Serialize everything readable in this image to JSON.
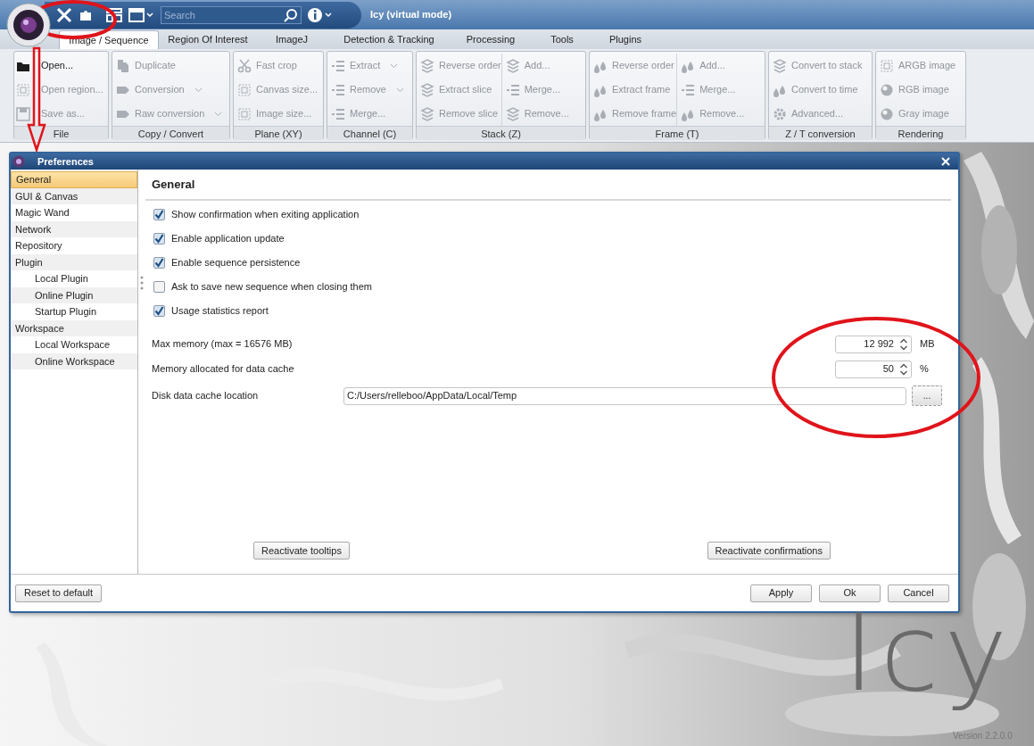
{
  "app_window": {
    "title": "Icy (virtual mode)",
    "search": {
      "placeholder": "Search"
    }
  },
  "ribbon_tabs": [
    {
      "label": "Image / Sequence",
      "selected": true
    },
    {
      "label": "Region Of Interest",
      "selected": false
    },
    {
      "label": "ImageJ",
      "selected": false
    },
    {
      "label": "Detection & Tracking",
      "selected": false
    },
    {
      "label": "Processing",
      "selected": false
    },
    {
      "label": "Tools",
      "selected": false
    },
    {
      "label": "Plugins",
      "selected": false
    }
  ],
  "ribbon_groups": [
    {
      "label": "File",
      "columns": [
        [
          {
            "label": "Open...",
            "disabled": false,
            "dropdown": false
          },
          {
            "label": "Open region...",
            "disabled": true,
            "dropdown": false
          },
          {
            "label": "Save as...",
            "disabled": true,
            "dropdown": false
          }
        ]
      ]
    },
    {
      "label": "Copy / Convert",
      "columns": [
        [
          {
            "label": "Duplicate",
            "disabled": true,
            "dropdown": false
          },
          {
            "label": "Conversion",
            "disabled": true,
            "dropdown": true
          },
          {
            "label": "Raw conversion",
            "disabled": true,
            "dropdown": true
          }
        ]
      ]
    },
    {
      "label": "Plane (XY)",
      "columns": [
        [
          {
            "label": "Fast crop",
            "disabled": true,
            "dropdown": false
          },
          {
            "label": "Canvas size...",
            "disabled": true,
            "dropdown": false
          },
          {
            "label": "Image size...",
            "disabled": true,
            "dropdown": false
          }
        ]
      ]
    },
    {
      "label": "Channel (C)",
      "columns": [
        [
          {
            "label": "Extract",
            "disabled": true,
            "dropdown": true
          },
          {
            "label": "Remove",
            "disabled": true,
            "dropdown": true
          },
          {
            "label": "Merge...",
            "disabled": true,
            "dropdown": false
          }
        ]
      ]
    },
    {
      "label": "Stack (Z)",
      "columns": [
        [
          {
            "label": "Reverse order",
            "disabled": true,
            "dropdown": false
          },
          {
            "label": "Extract slice",
            "disabled": true,
            "dropdown": false
          },
          {
            "label": "Remove slice",
            "disabled": true,
            "dropdown": false
          }
        ],
        [
          {
            "label": "Add...",
            "disabled": true,
            "dropdown": false
          },
          {
            "label": "Merge...",
            "disabled": true,
            "dropdown": false
          },
          {
            "label": "Remove...",
            "disabled": true,
            "dropdown": false
          }
        ]
      ]
    },
    {
      "label": "Frame (T)",
      "columns": [
        [
          {
            "label": "Reverse order",
            "disabled": true,
            "dropdown": false
          },
          {
            "label": "Extract frame",
            "disabled": true,
            "dropdown": false
          },
          {
            "label": "Remove frame",
            "disabled": true,
            "dropdown": false
          }
        ],
        [
          {
            "label": "Add...",
            "disabled": true,
            "dropdown": false
          },
          {
            "label": "Merge...",
            "disabled": true,
            "dropdown": false
          },
          {
            "label": "Remove...",
            "disabled": true,
            "dropdown": false
          }
        ]
      ]
    },
    {
      "label": "Z / T conversion",
      "columns": [
        [
          {
            "label": "Convert to stack",
            "disabled": true,
            "dropdown": false
          },
          {
            "label": "Convert to time",
            "disabled": true,
            "dropdown": false
          },
          {
            "label": "Advanced...",
            "disabled": true,
            "dropdown": false
          }
        ]
      ]
    },
    {
      "label": "Rendering",
      "columns": [
        [
          {
            "label": "ARGB image",
            "disabled": true,
            "dropdown": false
          },
          {
            "label": "RGB image",
            "disabled": true,
            "dropdown": false
          },
          {
            "label": "Gray image",
            "disabled": true,
            "dropdown": false
          }
        ]
      ]
    }
  ],
  "preferences": {
    "title": "Preferences",
    "sidebar": [
      {
        "label": "General",
        "selected": true
      },
      {
        "label": "GUI & Canvas",
        "selected": false
      },
      {
        "label": "Magic Wand",
        "selected": false
      },
      {
        "label": "Network",
        "selected": false
      },
      {
        "label": "Repository",
        "selected": false
      },
      {
        "label": "Plugin",
        "selected": false,
        "children": [
          {
            "label": "Local Plugin",
            "selected": false
          },
          {
            "label": "Online Plugin",
            "selected": false
          },
          {
            "label": "Startup Plugin",
            "selected": false
          }
        ]
      },
      {
        "label": "Workspace",
        "selected": false,
        "children": [
          {
            "label": "Local Workspace",
            "selected": false
          },
          {
            "label": "Online Workspace",
            "selected": false
          }
        ]
      }
    ],
    "heading": "General",
    "options": [
      {
        "label": "Show confirmation when exiting application",
        "checked": true
      },
      {
        "label": "Enable application update",
        "checked": true
      },
      {
        "label": "Enable sequence persistence",
        "checked": true
      },
      {
        "label": "Ask to save new sequence when closing them",
        "checked": false
      },
      {
        "label": "Usage statistics report",
        "checked": true
      }
    ],
    "fields": [
      {
        "kind": "spinner",
        "label": "Max memory (max = 16576 MB)",
        "value": "12 992",
        "unit": "MB"
      },
      {
        "kind": "spinner",
        "label": "Memory allocated for data cache",
        "value": "50",
        "unit": "%"
      },
      {
        "kind": "path",
        "label": "Disk data cache location",
        "value": "C:/Users/relleboo/AppData/Local/Temp",
        "button": "..."
      }
    ],
    "reactivate_buttons": [
      "Reactivate tooltips",
      "Reactivate confirmations"
    ],
    "reset_button": "Reset to default",
    "buttons": [
      "Apply",
      "Ok",
      "Cancel"
    ]
  },
  "desktop": {
    "logo": "Icy",
    "version": "Version 2.2.0.0"
  }
}
